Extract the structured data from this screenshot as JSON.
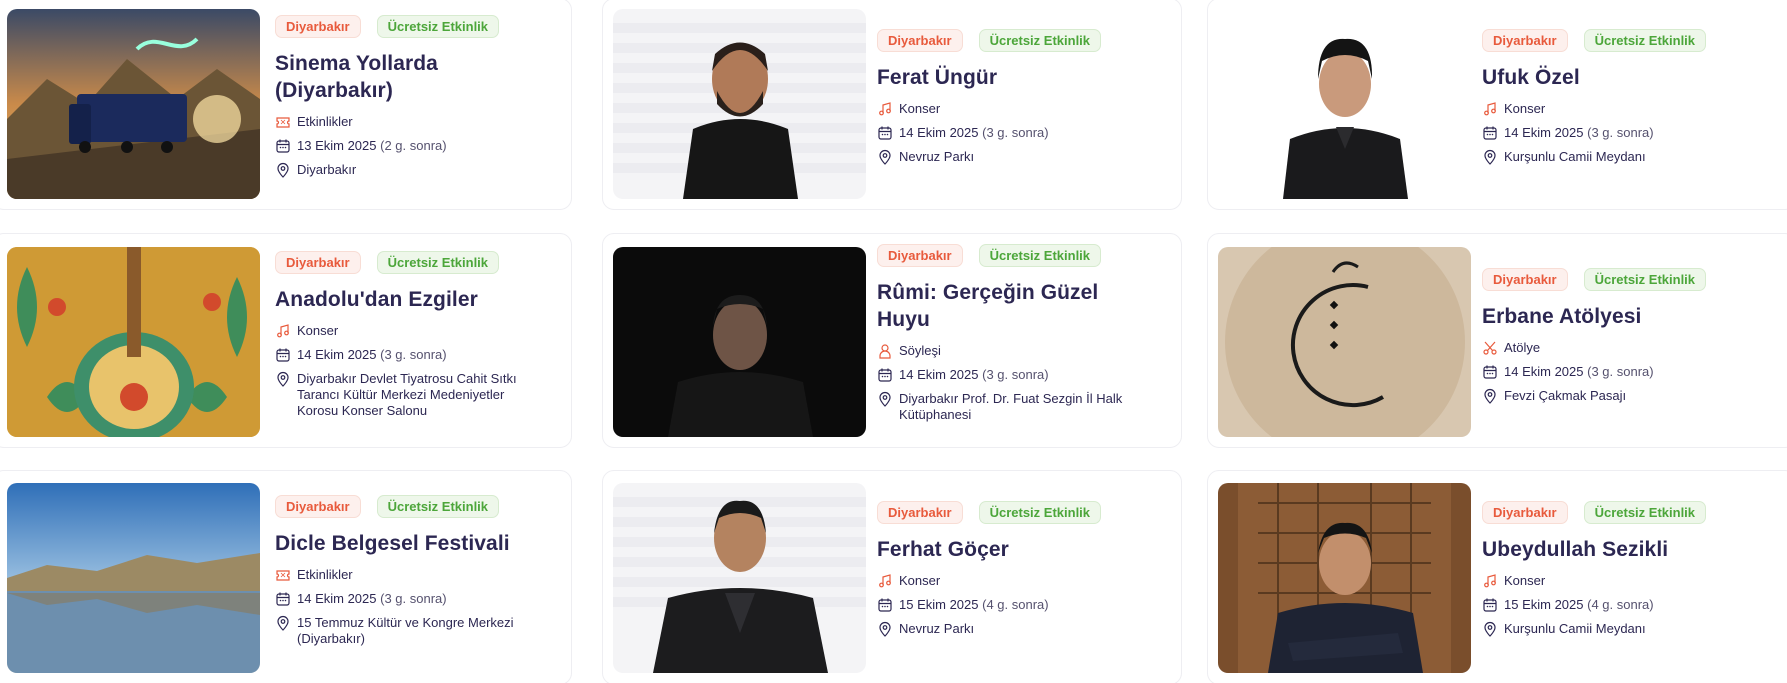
{
  "colors": {
    "title": "#2c2752",
    "city_badge_text": "#e85a3c",
    "free_badge_text": "#4ca63a",
    "category_icon": "#e85a3c"
  },
  "events": [
    {
      "city": "Diyarbakır",
      "price": "Ücretsiz Etkinlik",
      "title": "Sinema Yollarda (Diyarbakır)",
      "category": "Etkinlikler",
      "category_icon": "ticket-icon",
      "date": "13 Ekim 2025",
      "date_relative": "(2 g. sonra)",
      "venue": "Diyarbakır",
      "image": "cinema-truck-photo"
    },
    {
      "city": "Diyarbakır",
      "price": "Ücretsiz Etkinlik",
      "title": "Ferat Üngür",
      "category": "Konser",
      "category_icon": "music-icon",
      "date": "14 Ekim 2025",
      "date_relative": "(3 g. sonra)",
      "venue": "Nevruz Parkı",
      "image": "artist-portrait-photo"
    },
    {
      "city": "Diyarbakır",
      "price": "Ücretsiz Etkinlik",
      "title": "Ufuk Özel",
      "category": "Konser",
      "category_icon": "music-icon",
      "date": "14 Ekim 2025",
      "date_relative": "(3 g. sonra)",
      "venue": "Kurşunlu Camii Meydanı",
      "image": "artist-portrait-photo"
    },
    {
      "city": "Diyarbakır",
      "price": "Ücretsiz Etkinlik",
      "title": "Anadolu'dan Ezgiler",
      "category": "Konser",
      "category_icon": "music-icon",
      "date": "14 Ekim 2025",
      "date_relative": "(3 g. sonra)",
      "venue": "Diyarbakır Devlet Tiyatrosu Cahit Sıtkı Tarancı Kültür Merkezi Medeniyetler Korosu Konser Salonu",
      "image": "saz-illustration"
    },
    {
      "city": "Diyarbakır",
      "price": "Ücretsiz Etkinlik",
      "title": "Rûmi: Gerçeğin Güzel Huyu",
      "category": "Söyleşi",
      "category_icon": "speaker-icon",
      "date": "14 Ekim 2025",
      "date_relative": "(3 g. sonra)",
      "venue": "Diyarbakır Prof. Dr. Fuat Sezgin İl Halk Kütüphanesi",
      "image": "dark-portrait-photo"
    },
    {
      "city": "Diyarbakır",
      "price": "Ücretsiz Etkinlik",
      "title": "Erbane Atölyesi",
      "category": "Atölye",
      "category_icon": "scissors-icon",
      "date": "14 Ekim 2025",
      "date_relative": "(3 g. sonra)",
      "venue": "Fevzi Çakmak Pasajı",
      "image": "frame-drum-photo"
    },
    {
      "city": "Diyarbakır",
      "price": "Ücretsiz Etkinlik",
      "title": "Dicle Belgesel Festivali",
      "category": "Etkinlikler",
      "category_icon": "ticket-icon",
      "date": "14 Ekim 2025",
      "date_relative": "(3 g. sonra)",
      "venue": "15 Temmuz Kültür ve Kongre Merkezi (Diyarbakır)",
      "image": "landscape-lake-photo"
    },
    {
      "city": "Diyarbakır",
      "price": "Ücretsiz Etkinlik",
      "title": "Ferhat Göçer",
      "category": "Konser",
      "category_icon": "music-icon",
      "date": "15 Ekim 2025",
      "date_relative": "(4 g. sonra)",
      "venue": "Nevruz Parkı",
      "image": "artist-portrait-photo"
    },
    {
      "city": "Diyarbakır",
      "price": "Ücretsiz Etkinlik",
      "title": "Ubeydullah Sezikli",
      "category": "Konser",
      "category_icon": "music-icon",
      "date": "15 Ekim 2025",
      "date_relative": "(4 g. sonra)",
      "venue": "Kurşunlu Camii Meydanı",
      "image": "artist-portrait-photo"
    }
  ]
}
